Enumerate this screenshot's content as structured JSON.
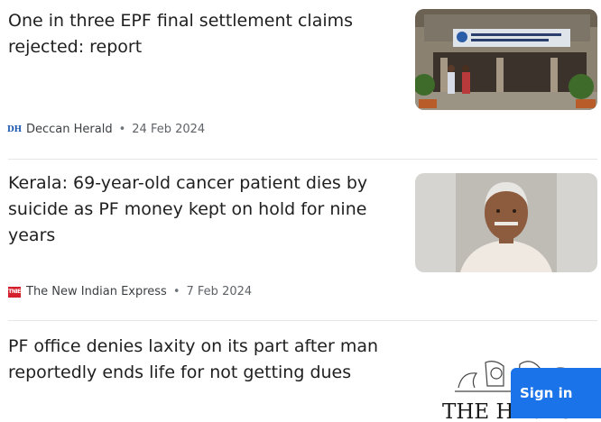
{
  "articles": [
    {
      "headline": "One in three EPF final settlement claims rejected: report",
      "source": "Deccan Herald",
      "source_logo_text": "DH",
      "date": "24 Feb 2024"
    },
    {
      "headline": "Kerala: 69-year-old cancer patient dies by suicide as PF money kept on hold for nine years",
      "source": "The New Indian Express",
      "source_logo_text": "TNIE",
      "date": "7 Feb 2024"
    },
    {
      "headline": "PF office denies laxity on its part after man reportedly ends life for not getting dues",
      "thumb_text": "THE HINDU"
    }
  ],
  "signin_label": "Sign in",
  "colors": {
    "accent": "#1a73e8",
    "tnie_red": "#d4202c",
    "dh_blue": "#1a56b0"
  }
}
